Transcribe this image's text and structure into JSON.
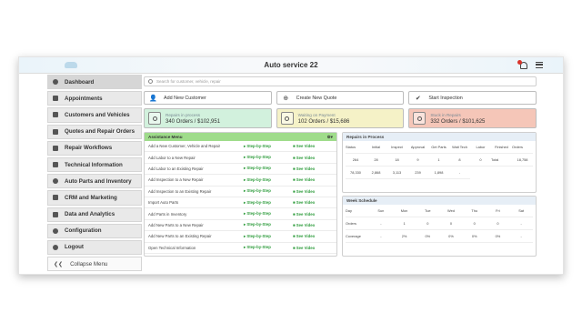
{
  "header": {
    "title": "Auto service 22"
  },
  "sidebar": {
    "items": [
      {
        "label": "Dashboard",
        "icon": "gauge-icon"
      },
      {
        "label": "Appointments",
        "icon": "calendar-icon"
      },
      {
        "label": "Customers and Vehicles",
        "icon": "car-icon"
      },
      {
        "label": "Quotes and Repair Orders",
        "icon": "clipboard-icon"
      },
      {
        "label": "Repair Workflows",
        "icon": "workflow-icon"
      },
      {
        "label": "Technical Information",
        "icon": "list-icon"
      },
      {
        "label": "Auto Parts and Inventory",
        "icon": "parts-icon"
      },
      {
        "label": "CRM and Marketing",
        "icon": "megaphone-icon"
      },
      {
        "label": "Data and Analytics",
        "icon": "chart-icon"
      },
      {
        "label": "Configuration",
        "icon": "gear-icon"
      },
      {
        "label": "Logout",
        "icon": "logout-icon"
      }
    ],
    "collapse_label": "Collapse Menu"
  },
  "search": {
    "placeholder": "Search for customer, vehicle, repair"
  },
  "actions": [
    {
      "label": "Add New Customer",
      "icon": "add-user-icon"
    },
    {
      "label": "Create New Quote",
      "icon": "plus-circle-icon"
    },
    {
      "label": "Start Inspection",
      "icon": "check-icon"
    }
  ],
  "stats": [
    {
      "label": "Repairs in process",
      "value": "340 Orders / $102,951",
      "color": "#d2f1dd"
    },
    {
      "label": "Waiting on Payment",
      "value": "102 Orders / $15,686",
      "color": "#f5f2c7"
    },
    {
      "label": "Stuck in Repairs",
      "value": "332 Orders / $101,625",
      "color": "#f5c6b8"
    }
  ],
  "assistance": {
    "title": "Assistance Menu",
    "header_icons": "⚙▾",
    "rows": [
      {
        "text": "Add a New Customer, Vehicle and Repair",
        "step": "Step-by-Step",
        "video": "See Video"
      },
      {
        "text": "Add Labor to a New Repair",
        "step": "Step-by-Step",
        "video": "See Video"
      },
      {
        "text": "Add Labor to an Existing Repair",
        "step": "Step-by-Step",
        "video": "See Video"
      },
      {
        "text": "Add Inspection to a New Repair",
        "step": "Step-by-Step",
        "video": "See Video"
      },
      {
        "text": "Add Inspection to an Existing Repair",
        "step": "Step-by-Step",
        "video": "See Video"
      },
      {
        "text": "Import Auto Parts",
        "step": "Step-by-Step",
        "video": "See Video"
      },
      {
        "text": "Add Parts in Inventory",
        "step": "Step-by-Step",
        "video": "See Video"
      },
      {
        "text": "Add New Parts to a New Repair",
        "step": "Step-by-Step",
        "video": "See Video"
      },
      {
        "text": "Add New Parts to an Existing Repair",
        "step": "Step-by-Step",
        "video": "See Video"
      },
      {
        "text": "Open Technical Information",
        "step": "Step-by-Step",
        "video": "See Video"
      }
    ]
  },
  "repairs_in_process": {
    "title": "Repairs in Process",
    "columns": [
      "Status",
      "Initial",
      "Inspect",
      "Approval",
      "Get Parts",
      "Wait Tech",
      "Labor",
      "Finished"
    ],
    "rows": [
      [
        "Orders",
        "264",
        "28",
        "18",
        "9",
        "1",
        "8",
        "0"
      ],
      [
        "Total",
        "18,758",
        "78,330",
        "2,868",
        "3,113",
        "239",
        "1,898",
        "-"
      ]
    ]
  },
  "week_schedule": {
    "title": "Week Schedule",
    "columns": [
      "Day",
      "Sun",
      "Mon",
      "Tue",
      "Wed",
      "Thu",
      "Fri",
      "Sat"
    ],
    "rows": [
      [
        "Orders",
        "-",
        "1",
        "0",
        "0",
        "0",
        "0",
        "-"
      ],
      [
        "Coverage",
        "-",
        "2%",
        "0%",
        "0%",
        "0%",
        "0%",
        "-"
      ]
    ]
  }
}
